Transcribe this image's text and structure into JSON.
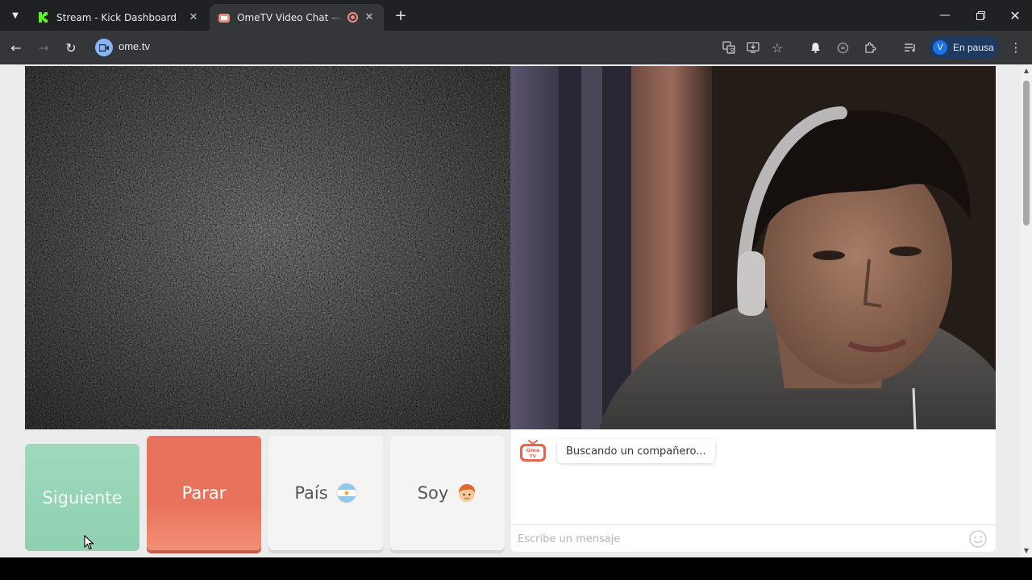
{
  "browser": {
    "tabs": [
      {
        "title": "Stream - Kick Dashboard",
        "active": false
      },
      {
        "title": "OmeTV Video Chat — OmeTV",
        "active": true
      }
    ],
    "url": "ome.tv",
    "profile": {
      "initial": "V",
      "label": "En pausa"
    },
    "icons": [
      "tab-list-icon",
      "close-icon",
      "record-icon",
      "new-tab-icon",
      "minimize-icon",
      "restore-icon",
      "window-close-icon",
      "back-icon",
      "forward-icon",
      "reload-icon",
      "translate-icon",
      "install-icon",
      "star-icon",
      "bell-icon",
      "extension-circle-icon",
      "puzzle-icon",
      "reading-list-icon",
      "menu-dots-icon"
    ],
    "colors": {
      "kick_green": "#53fc18",
      "accent_blue": "#8ab4f8",
      "tabbar": "#202124",
      "toolbar": "#35363a"
    }
  },
  "ometv": {
    "buttons": {
      "next": "Siguiente",
      "stop": "Parar",
      "country": "País",
      "gender": "Soy"
    },
    "chat": {
      "status_message": "Buscando un compañero...",
      "input_placeholder": "Escribe un mensaje"
    },
    "colors": {
      "next": "#9fd8bd",
      "stop": "#e8735c",
      "neutral": "#f4f4f4"
    }
  }
}
